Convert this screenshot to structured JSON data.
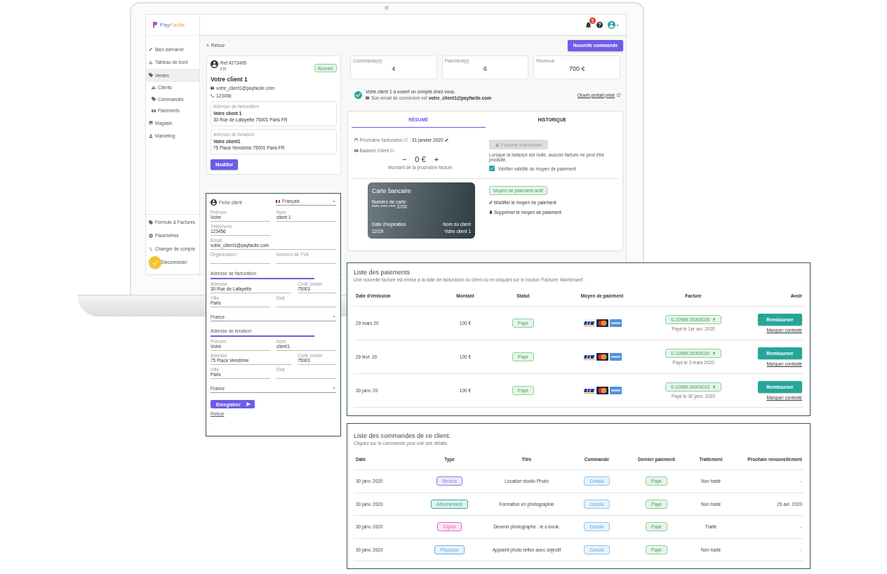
{
  "sidebar": {
    "logo": {
      "first": "Pay",
      "second": "Facile"
    },
    "items": [
      {
        "label": "Bien démarrer",
        "selected": false
      },
      {
        "label": "Tableau de bord",
        "selected": false
      },
      {
        "label": "Ventes",
        "selected": true,
        "children": [
          {
            "label": "Clients",
            "selected": false
          },
          {
            "label": "Commandes",
            "selected": false
          },
          {
            "label": "Paiements",
            "selected": false
          }
        ]
      },
      {
        "label": "Magasin",
        "selected": false
      },
      {
        "label": "Marketing",
        "selected": false
      }
    ],
    "bottom_items": [
      {
        "label": "Formule & Factures",
        "selected": false
      },
      {
        "label": "Paramètres",
        "selected": false
      },
      {
        "label": "Changer de compte",
        "selected": false
      },
      {
        "label": "Déconnecter",
        "selected": false
      }
    ]
  },
  "topbar": {
    "notifications": "5"
  },
  "back_link": "Retour",
  "new_order_button": "Nouvelle commande",
  "client_card": {
    "ref": "Ref #273495",
    "lang": "FR",
    "status": "Abonné",
    "name": "Votre client 1",
    "email": "votre_client1@payfacile.com",
    "phone": "123456",
    "addresses": [
      {
        "label": "Adresse de facturation",
        "name": "Votre client 1",
        "line": "30 Rue de Lafayette 75001 Paris FR"
      },
      {
        "label": "Adresse de livraison",
        "name": "Votre client1",
        "line": "75 Place Vendôme 75001 Paris FR"
      }
    ],
    "edit_button": "Modifier"
  },
  "stats": [
    {
      "label": "Commande(s)",
      "value": "4"
    },
    {
      "label": "Paiement(s)",
      "value": "6"
    },
    {
      "label": "Revenus",
      "value": "700 €"
    }
  ],
  "account_notice": {
    "title": "Votre client 1 a ouvert un compte chez vous.",
    "detail": "Son email de connexion est **votre_client1@payfacile.com**",
    "portal_link": "Ouvrir portail privé"
  },
  "summary": {
    "tabs": [
      {
        "label": "RÉSUMÉ",
        "selected": true
      },
      {
        "label": "HISTORIQUE",
        "selected": false
      }
    ],
    "next_billing_label": "Prochaine facturation",
    "next_billing_date": ": 31 janvier 2020",
    "balance_label": "Balance Client",
    "decrement": "−",
    "amount": "0 €",
    "increment": "+",
    "amount_caption": "Montant de la prochaine facture",
    "bill_now": {
      "label": "Facturer maintenant",
      "disabled": true
    },
    "bill_note": "Lorsque la balance est nulle, aucune facture ne peut être produite.",
    "verify": {
      "label": "Vérifier validité du moyen de paiement",
      "checked": true
    },
    "card": {
      "title": "Carte bancaire",
      "number_label": "Numéro de carte:",
      "number": "****.****.****.3700",
      "expiry_label": "Date d'expiration",
      "expiry": "12/29",
      "holder_label": "Nom du client",
      "holder": "Votre client 1"
    },
    "payment_status": "Moyen de paiement actif",
    "actions": [
      "Modifier le moyen de paiement",
      "Supprimer le moyen de paiement"
    ]
  },
  "client_form": {
    "title": "Fiche client",
    "language": "Français",
    "sections": [
      {
        "rows": [
          [
            {
              "kind": "text",
              "label": "Prénom",
              "value": "Votre"
            },
            {
              "kind": "text",
              "label": "Nom",
              "value": "client 1"
            }
          ],
          [
            {
              "kind": "half",
              "label": "Téléphone",
              "value": "123456"
            }
          ],
          [
            {
              "kind": "text",
              "label": "Email",
              "value": "votre_client1@payfacile.com"
            }
          ],
          [
            {
              "kind": "text",
              "label": "Organisation"
            },
            {
              "kind": "text",
              "label": "Numéro de TVA"
            }
          ]
        ]
      },
      {
        "title": "Adresse de facturation",
        "rows": [
          [
            {
              "kind": "wide",
              "label": "Adresse",
              "value": "30 Rue de Lafayette"
            },
            {
              "kind": "text",
              "label": "Code postal",
              "value": "75001"
            }
          ],
          [
            {
              "kind": "text",
              "label": "Ville",
              "value": "Paris"
            },
            {
              "kind": "text",
              "label": "État"
            }
          ],
          [
            {
              "kind": "select",
              "value": "France"
            }
          ]
        ]
      },
      {
        "title": "Adresse de livraison",
        "rows": [
          [
            {
              "kind": "text",
              "label": "Prénom",
              "value": "Votre"
            },
            {
              "kind": "text",
              "label": "Nom",
              "value": "client1"
            }
          ],
          [
            {
              "kind": "wide",
              "label": "Adresse",
              "value": "75 Place Vendôme"
            },
            {
              "kind": "text",
              "label": "Code postal",
              "value": "75001"
            }
          ],
          [
            {
              "kind": "text",
              "label": "Ville",
              "value": "Paris"
            },
            {
              "kind": "text",
              "label": "État"
            }
          ],
          [
            {
              "kind": "select",
              "value": "France"
            }
          ]
        ]
      }
    ],
    "save_button": "Enregistrer",
    "back_link": "Retour"
  },
  "payments": {
    "title": "Liste des paiements",
    "subtitle": "Une nouvelle facture est émise à la date de facturation du client ou en cliquant sur le bouton 'Facturer Maintenant'.",
    "columns": [
      "Date d'émission",
      "Montant",
      "Statut",
      "Moyen de paiement",
      "Facture",
      "Avoir"
    ],
    "rows": [
      {
        "date": "29 mars 20",
        "amount": "100 €",
        "status": "Payé",
        "invoice": "S-10989.00000028",
        "paid_on": "Payé le 1er avr. 2020",
        "refund": "Rembourser",
        "dispute": "Marquer contesté"
      },
      {
        "date": "29 févr. 20",
        "amount": "100 €",
        "status": "Payé",
        "invoice": "S-10989.00000020",
        "paid_on": "Payé le 3 mars 2020",
        "refund": "Rembourser",
        "dispute": "Marquer contesté"
      },
      {
        "date": "30 janv. 20",
        "amount": "100 €",
        "status": "Payé",
        "invoice": "S-10989.00000015",
        "paid_on": "Payé le 30 janv. 2020",
        "refund": "Rembourser",
        "dispute": "Marquer contesté"
      }
    ]
  },
  "orders": {
    "title": "Liste des commandes de ce client.",
    "subtitle": "Cliquez sur la commande pour voir ses détails.",
    "columns": [
      "Date",
      "Type",
      "Titre",
      "Commande",
      "Dernier paiement",
      "Traitement",
      "Prochain renouvellement"
    ],
    "rows": [
      {
        "date": "30 janv. 2020",
        "type": "Service",
        "color": "#8a7ee0",
        "title": "Location studio Photo",
        "order": "Conclu",
        "payment": "Payé",
        "processing": "Non traité",
        "renewal": "-"
      },
      {
        "date": "30 janv. 2020",
        "type": "Abonnement",
        "color": "#3aa893",
        "title": "Formation en photographie",
        "order": "Conclu",
        "payment": "Payé",
        "processing": "Non traité",
        "renewal": "29 avr. 2020"
      },
      {
        "date": "30 janv. 2020",
        "type": "Digital",
        "color": "#e06ac0",
        "title": "Devenir photographe : le e-book.",
        "order": "Conclu",
        "payment": "Payé",
        "processing": "Traité",
        "renewal": "-"
      },
      {
        "date": "30 janv. 2020",
        "type": "Physique",
        "color": "#6ab0e8",
        "title": "Appareil photo reflex avec objectif",
        "order": "Conclu",
        "payment": "Payé",
        "processing": "Non traité",
        "renewal": "-"
      }
    ]
  }
}
